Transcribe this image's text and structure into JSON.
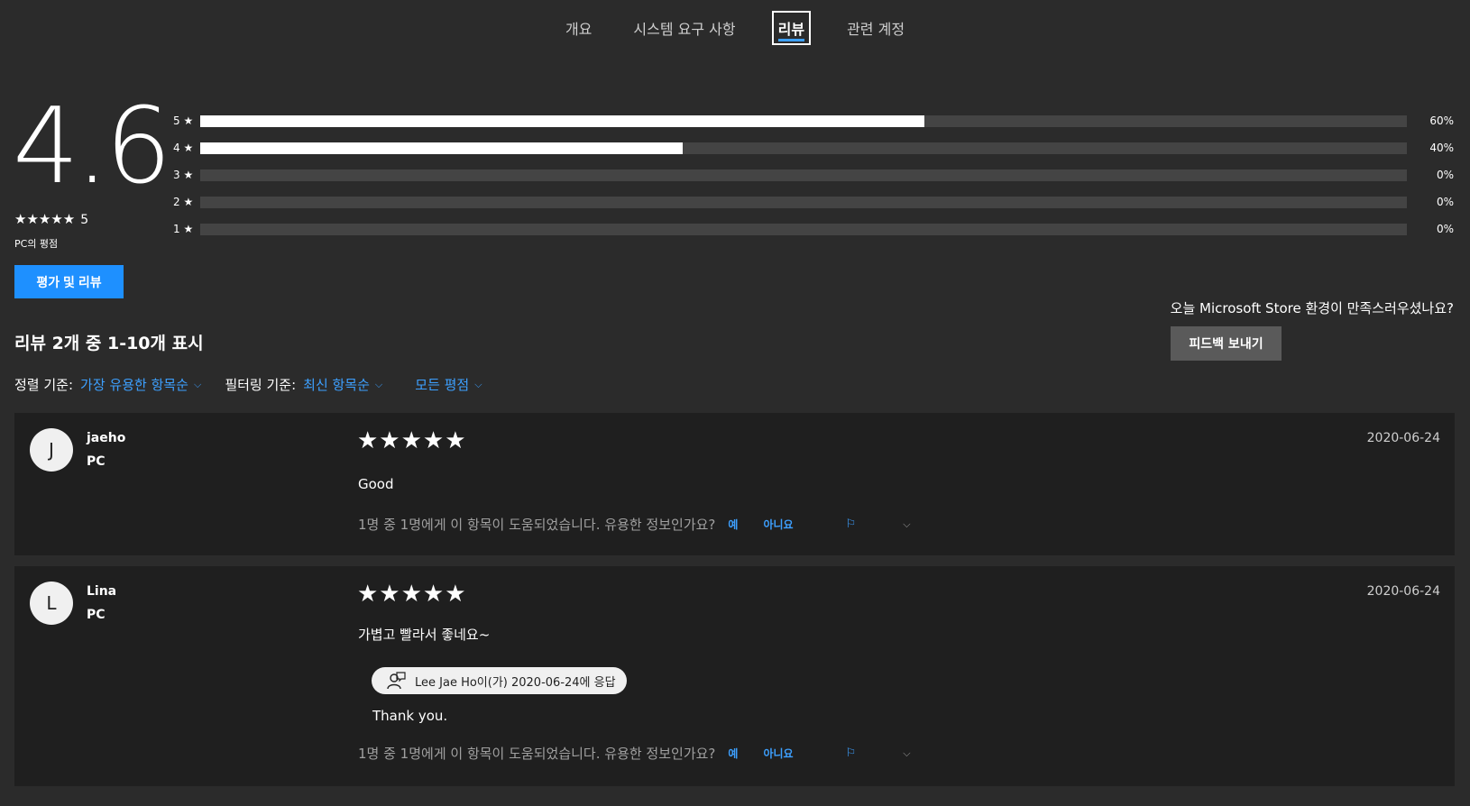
{
  "nav": {
    "tabs": [
      "개요",
      "시스템 요구 사항",
      "리뷰",
      "관련 계정"
    ],
    "active_index": 2
  },
  "summary": {
    "rating": "4.6",
    "stars": "★★★★★",
    "count": "5",
    "pc_label": "PC의 평점",
    "bars": [
      {
        "label": "5 ★",
        "pct_text": "60%",
        "pct": 60
      },
      {
        "label": "4 ★",
        "pct_text": "40%",
        "pct": 40
      },
      {
        "label": "3 ★",
        "pct_text": "0%",
        "pct": 0
      },
      {
        "label": "2 ★",
        "pct_text": "0%",
        "pct": 0
      },
      {
        "label": "1 ★",
        "pct_text": "0%",
        "pct": 0
      }
    ]
  },
  "rate_button": "평가 및 리뷰",
  "feedback": {
    "question": "오늘 Microsoft Store 환경이 만족스러우셨나요?",
    "button": "피드백 보내기"
  },
  "review_count": "리뷰 2개 중 1-10개 표시",
  "filters": {
    "sort_label": "정렬 기준:",
    "sort_value": "가장 유용한 항목순",
    "filter_label": "필터링 기준:",
    "filter_value": "최신 항목순",
    "rating_value": "모든 평점",
    "chevron": "⌵"
  },
  "reviews": [
    {
      "initial": "J",
      "name": "jaeho",
      "platform": "PC",
      "stars": "★★★★★",
      "date": "2020-06-24",
      "text": "Good",
      "helpful": "1명 중 1명에게 이 항목이 도움되었습니다. 유용한 정보인가요?",
      "yes": "예",
      "no": "아니요"
    },
    {
      "initial": "L",
      "name": "Lina",
      "platform": "PC",
      "stars": "★★★★★",
      "date": "2020-06-24",
      "text": "가볍고 빨라서 좋네요~",
      "reply_pill": "Lee Jae Ho이(가) 2020-06-24에 응답",
      "reply_text": "Thank you.",
      "helpful": "1명 중 1명에게 이 항목이 도움되었습니다. 유용한 정보인가요?",
      "yes": "예",
      "no": "아니요"
    }
  ],
  "icons": {
    "flag": "⚐",
    "more": "⌵"
  },
  "colors": {
    "accent": "#1e90ff",
    "link": "#3da0ff",
    "background": "#2b2b2b",
    "card": "#1f1f1f"
  }
}
